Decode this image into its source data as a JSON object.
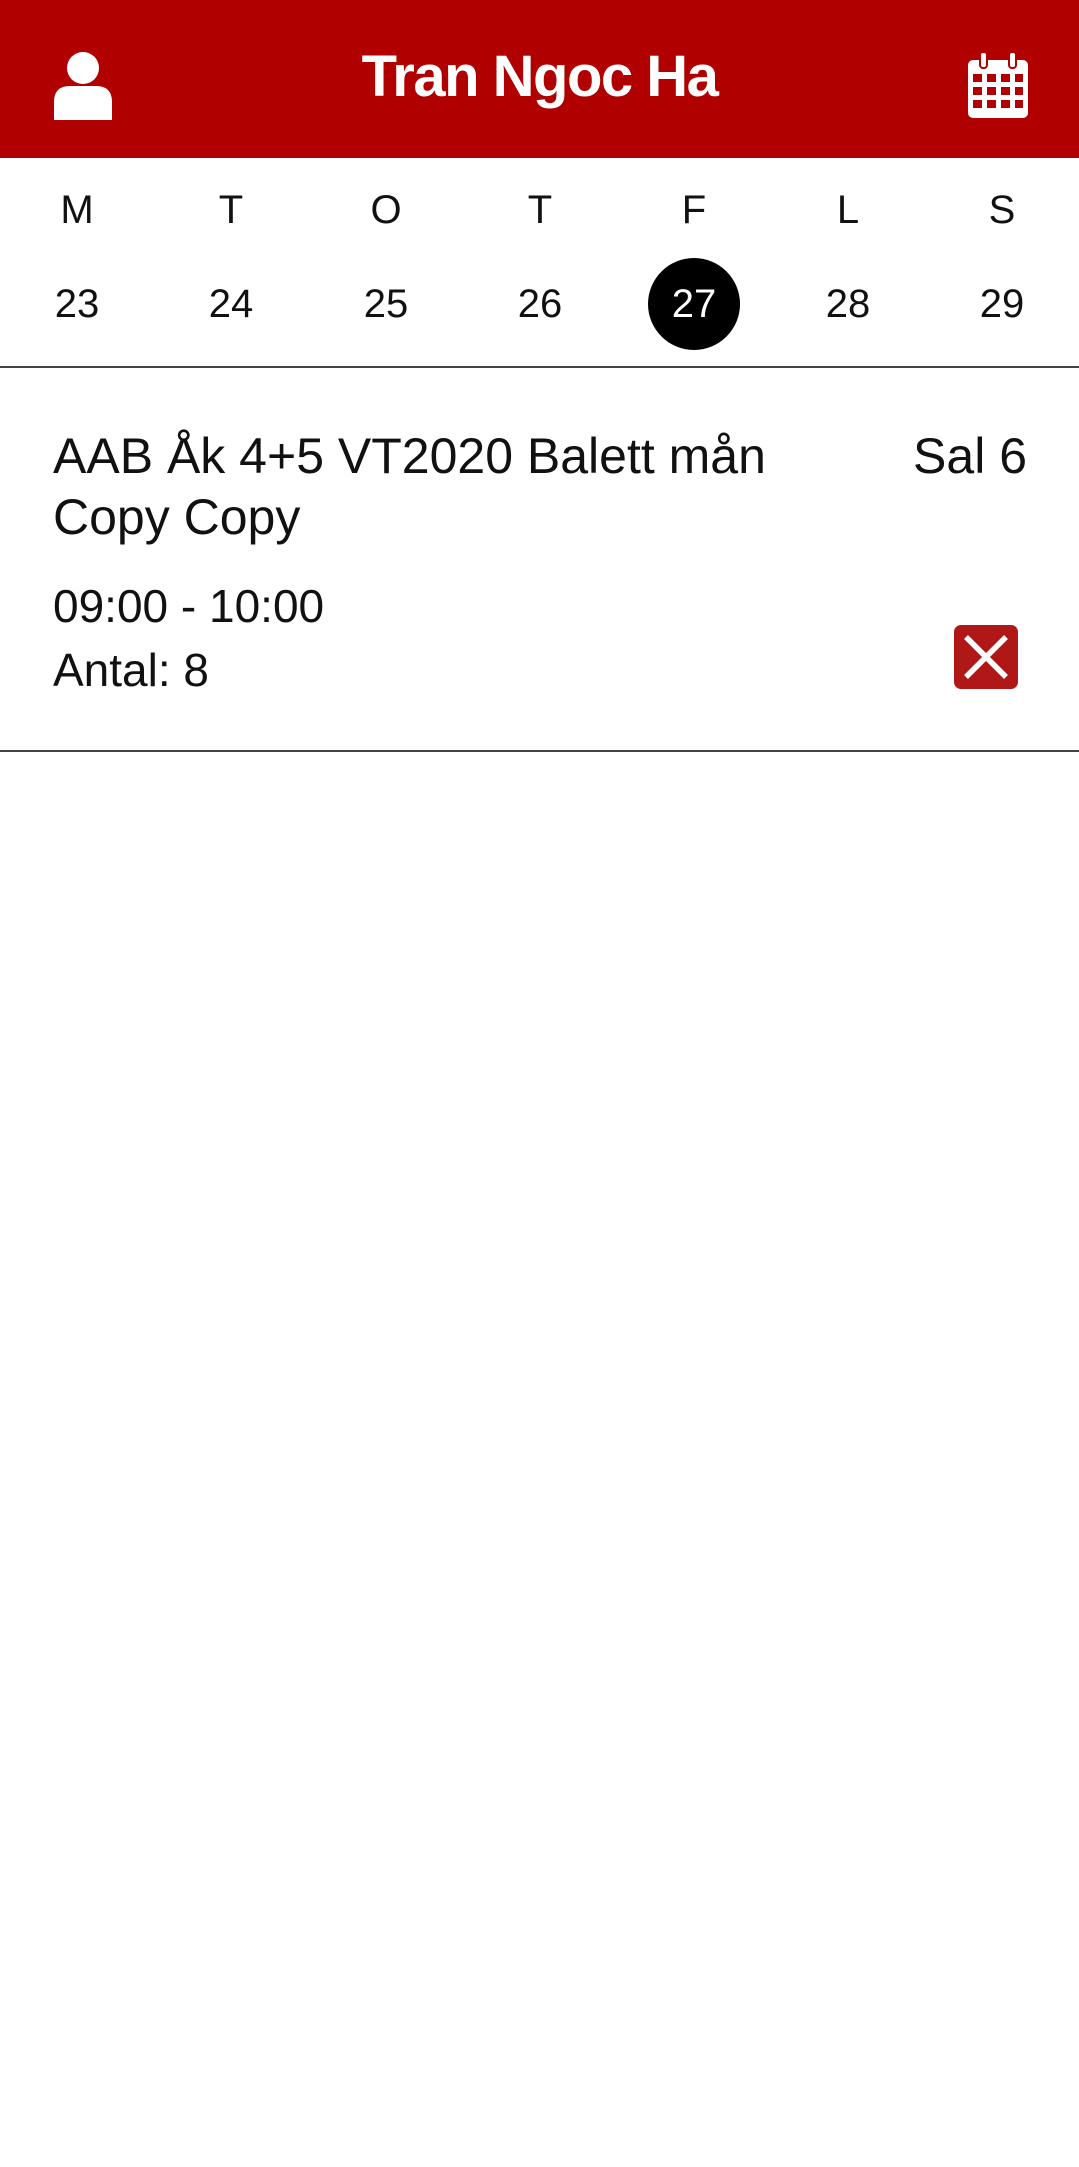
{
  "header": {
    "title": "Tran Ngoc Ha",
    "background_color": "#b00000",
    "left_icon": "user-icon",
    "right_icon": "calendar-icon"
  },
  "week": {
    "days": [
      {
        "letter": "M",
        "date": "23"
      },
      {
        "letter": "T",
        "date": "24"
      },
      {
        "letter": "O",
        "date": "25"
      },
      {
        "letter": "T",
        "date": "26"
      },
      {
        "letter": "F",
        "date": "27",
        "selected": true
      },
      {
        "letter": "L",
        "date": "28"
      },
      {
        "letter": "S",
        "date": "29"
      }
    ],
    "selected_color": "#000000"
  },
  "event": {
    "name": "AAB Åk 4+5 VT2020 Balett mån Copy Copy",
    "room": "Sal 6",
    "time": "09:00 - 10:00",
    "count_label": "Antal:",
    "count_value": "8",
    "cancel_icon": "close-box-icon",
    "cancel_color": "#b01818"
  }
}
